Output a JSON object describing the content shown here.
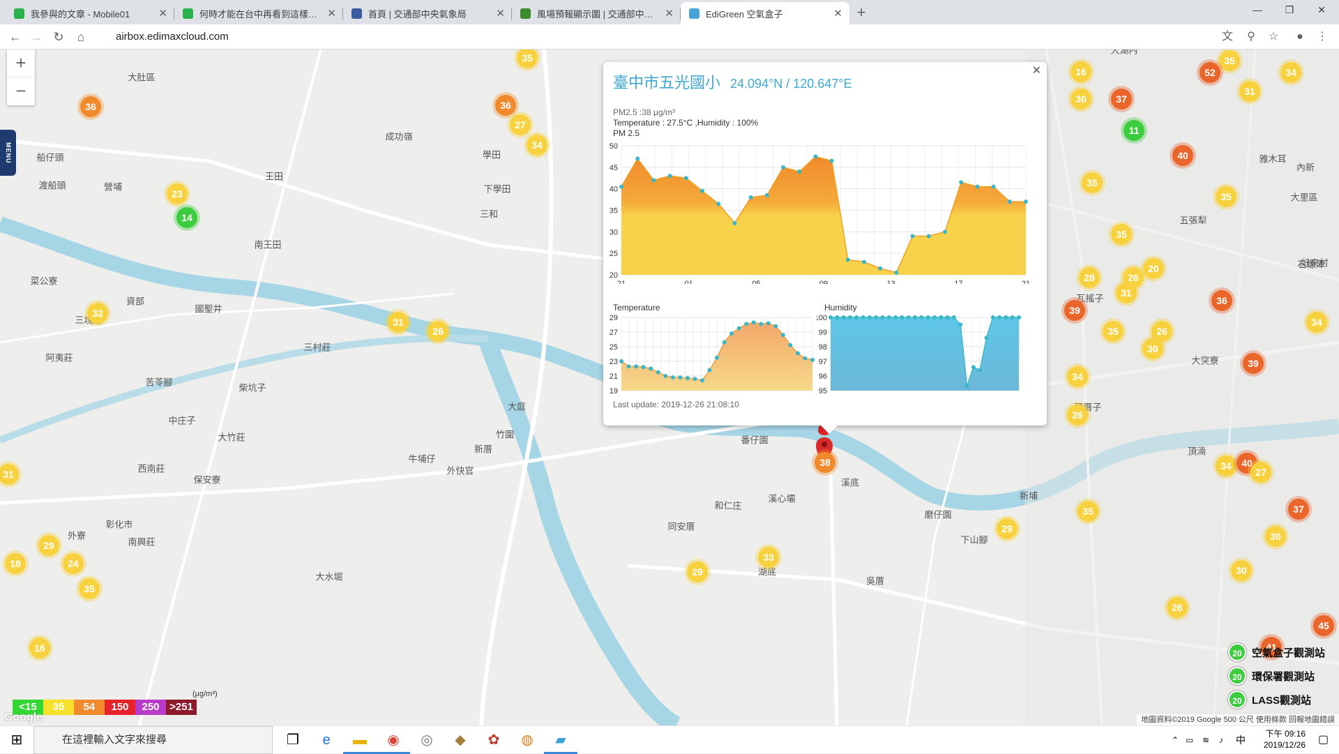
{
  "browser": {
    "tabs": [
      {
        "title": "我參與的文章 - Mobile01",
        "color": "#2bb24c",
        "active": false
      },
      {
        "title": "何時才能在台中再看到這樣的藍天",
        "color": "#2bb24c",
        "active": false
      },
      {
        "title": "首頁 | 交通部中央氣象局",
        "color": "#3a5ba0",
        "active": false
      },
      {
        "title": "風場預報顯示圖 | 交通部中央氣象局",
        "color": "#3c8a2e",
        "active": false
      },
      {
        "title": "EdiGreen 空氣盒子",
        "color": "#4aa3d6",
        "active": true
      }
    ],
    "url": "airbox.edimaxcloud.com"
  },
  "map": {
    "zoom_in": "+",
    "zoom_out": "−",
    "menu_label": "MENU",
    "markers": [
      {
        "v": "36",
        "c": "mk-o"
      },
      {
        "v": "35",
        "c": "mk-y"
      },
      {
        "v": "36",
        "c": "mk-o"
      },
      {
        "v": "27",
        "c": "mk-y"
      },
      {
        "v": "34",
        "c": "mk-y"
      },
      {
        "v": "14",
        "c": "mk-g"
      },
      {
        "v": "31",
        "c": "mk-y"
      },
      {
        "v": "26",
        "c": "mk-y"
      },
      {
        "v": "32",
        "c": "mk-y"
      },
      {
        "v": "31",
        "c": "mk-y"
      },
      {
        "v": "29",
        "c": "mk-y"
      },
      {
        "v": "24",
        "c": "mk-y"
      },
      {
        "v": "18",
        "c": "mk-y"
      },
      {
        "v": "35",
        "c": "mk-y"
      },
      {
        "v": "38",
        "c": "mk-o"
      },
      {
        "v": "33",
        "c": "mk-y"
      },
      {
        "v": "29",
        "c": "mk-y"
      },
      {
        "v": "29",
        "c": "mk-y"
      },
      {
        "v": "16",
        "c": "mk-y"
      },
      {
        "v": "35",
        "c": "mk-y"
      },
      {
        "v": "52",
        "c": "mk-r"
      },
      {
        "v": "34",
        "c": "mk-y"
      },
      {
        "v": "16",
        "c": "mk-y"
      },
      {
        "v": "30",
        "c": "mk-y"
      },
      {
        "v": "37",
        "c": "mk-r"
      },
      {
        "v": "31",
        "c": "mk-y"
      },
      {
        "v": "11",
        "c": "mk-g"
      },
      {
        "v": "40",
        "c": "mk-r"
      },
      {
        "v": "35",
        "c": "mk-y"
      },
      {
        "v": "35",
        "c": "mk-y"
      },
      {
        "v": "35",
        "c": "mk-y"
      },
      {
        "v": "28",
        "c": "mk-y"
      },
      {
        "v": "26",
        "c": "mk-y"
      },
      {
        "v": "20",
        "c": "mk-y"
      },
      {
        "v": "31",
        "c": "mk-y"
      },
      {
        "v": "36",
        "c": "mk-r"
      },
      {
        "v": "34",
        "c": "mk-y"
      },
      {
        "v": "39",
        "c": "mk-r"
      },
      {
        "v": "35",
        "c": "mk-y"
      },
      {
        "v": "26",
        "c": "mk-y"
      },
      {
        "v": "30",
        "c": "mk-y"
      },
      {
        "v": "39",
        "c": "mk-r"
      },
      {
        "v": "34",
        "c": "mk-y"
      },
      {
        "v": "26",
        "c": "mk-y"
      },
      {
        "v": "34",
        "c": "mk-y"
      },
      {
        "v": "40",
        "c": "mk-r"
      },
      {
        "v": "27",
        "c": "mk-y"
      },
      {
        "v": "35",
        "c": "mk-y"
      },
      {
        "v": "37",
        "c": "mk-r"
      },
      {
        "v": "30",
        "c": "mk-y"
      },
      {
        "v": "30",
        "c": "mk-y"
      },
      {
        "v": "26",
        "c": "mk-y"
      },
      {
        "v": "45",
        "c": "mk-r"
      },
      {
        "v": "41",
        "c": "mk-r"
      },
      {
        "v": "23",
        "c": "mk-y"
      }
    ],
    "place_labels": [
      "大肚區",
      "成功嶺",
      "學田",
      "下學田",
      "王田",
      "南王田",
      "三和",
      "船仔頭",
      "渡船頭",
      "營埔",
      "菜公寮",
      "三塊厝",
      "國聖井",
      "資部",
      "阿夷莊",
      "三村莊",
      "苦苓腳",
      "柴坑子",
      "中庄子",
      "大竹莊",
      "牛埔仔",
      "外快官",
      "大庭",
      "竹圍",
      "新厝",
      "番仔園",
      "溪底",
      "溪心壩",
      "和仁庄",
      "同安厝",
      "磨仔園",
      "新埔",
      "頂厝子",
      "大突寮",
      "雅木耳",
      "內新",
      "大里區",
      "五張犁",
      "瓦搖子",
      "阿密哩",
      "中興",
      "公館路",
      "大湖內",
      "好來村",
      "石螺潭",
      "湖底",
      "吳厝",
      "下山腳",
      "西南莊",
      "保安寮",
      "彰化市",
      "南興莊",
      "外寮",
      "大水堀",
      "頂湳"
    ],
    "legend_unit": "(μg/m³)",
    "legend": [
      {
        "label": "<15",
        "color": "#33d633"
      },
      {
        "label": "35",
        "color": "#f5e12b"
      },
      {
        "label": "54",
        "color": "#f08a2c"
      },
      {
        "label": "150",
        "color": "#e8222b"
      },
      {
        "label": "250",
        "color": "#b83bc9"
      },
      {
        "label": ">251",
        "color": "#8b1a2b"
      }
    ],
    "station_legend": [
      {
        "label": "空氣盒子觀測站",
        "value": "20"
      },
      {
        "label": "環保署觀測站",
        "value": "20"
      },
      {
        "label": "LASS觀測站",
        "value": "20"
      }
    ],
    "attribution": "地圖資料©2019 Google   500 公尺   使用條款   回報地圖錯誤",
    "google_logo": "Google"
  },
  "popup": {
    "title": "臺中市五光國小",
    "coords": "24.094°N / 120.647°E",
    "pm_line": "PM2.5 :38 μg/m³",
    "temp_line": "Temperature : 27.5°C ,Humidity : 100%",
    "pm_heading": "PM 2.5",
    "temp_heading": "Temperature",
    "hum_heading": "Humidity",
    "last_update": "Last update: 2019-12-26 21:08:10"
  },
  "chart_data": [
    {
      "type": "area",
      "title": "PM 2.5",
      "x_ticks": [
        "21",
        "01",
        "05",
        "09",
        "13",
        "17",
        "21"
      ],
      "ylim": [
        20,
        50
      ],
      "y_ticks": [
        20,
        25,
        30,
        35,
        40,
        45,
        50
      ],
      "values": [
        40.5,
        47,
        42,
        43,
        42.5,
        39.5,
        36.5,
        32,
        38,
        38.5,
        45,
        44,
        47.5,
        46.5,
        23.5,
        23,
        21.5,
        20.5,
        29,
        29,
        30,
        41.5,
        40.5,
        40.5,
        37,
        37
      ]
    },
    {
      "type": "area",
      "title": "Temperature",
      "ylim": [
        19,
        29
      ],
      "y_ticks": [
        19,
        21,
        23,
        25,
        27,
        29
      ],
      "values": [
        23,
        22.3,
        22.3,
        22.2,
        22,
        21.5,
        21,
        20.8,
        20.8,
        20.7,
        20.6,
        20.4,
        21.8,
        23.5,
        25.6,
        26.8,
        27.5,
        28.1,
        28.3,
        28.1,
        28.2,
        27.8,
        26.6,
        25.2,
        24.1,
        23.4,
        23.2
      ]
    },
    {
      "type": "area",
      "title": "Humidity",
      "ylim": [
        95,
        100
      ],
      "y_ticks": [
        95,
        96,
        97,
        98,
        99,
        100
      ],
      "values": [
        100,
        100,
        100,
        100,
        100,
        100,
        100,
        100,
        100,
        100,
        100,
        100,
        100,
        100,
        100,
        100,
        100,
        100,
        100,
        100,
        99.5,
        95.3,
        96.6,
        96.4,
        98.6,
        100,
        100,
        100,
        100,
        100
      ]
    }
  ],
  "taskbar": {
    "search_placeholder": "在這裡輸入文字來搜尋",
    "time": "下午 09:16",
    "date": "2019/12/26",
    "ime": "中"
  }
}
